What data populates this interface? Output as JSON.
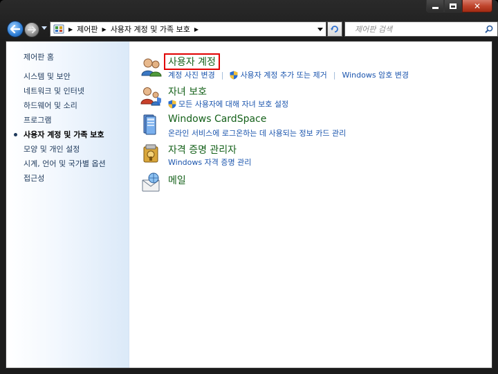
{
  "window": {
    "caption": {
      "minimize": "minimize",
      "maximize": "maximize",
      "close": "✕"
    }
  },
  "address": {
    "crumbs": [
      "제어판",
      "사용자 계정 및 가족 보호"
    ]
  },
  "search": {
    "placeholder": "제어판 검색"
  },
  "sidebar": {
    "home": "제어판 홈",
    "items": [
      {
        "label": "시스템 및 보안"
      },
      {
        "label": "네트워크 및 인터넷"
      },
      {
        "label": "하드웨어 및 소리"
      },
      {
        "label": "프로그램"
      },
      {
        "label": "사용자 계정 및 가족 보호",
        "current": true
      },
      {
        "label": "모양 및 개인 설정"
      },
      {
        "label": "시계, 언어 및 국가별 옵션"
      },
      {
        "label": "접근성"
      }
    ]
  },
  "categories": [
    {
      "title": "사용자 계정",
      "icon": "user-accounts-icon",
      "links": [
        {
          "label": "계정 사진 변경",
          "shield": false
        },
        {
          "label": "사용자 계정 추가 또는 제거",
          "shield": true
        },
        {
          "label": "Windows 암호 변경",
          "shield": false
        }
      ]
    },
    {
      "title": "자녀 보호",
      "icon": "parental-controls-icon",
      "links": [
        {
          "label": "모든 사용자에 대해 자녀 보호 설정",
          "shield": true
        }
      ]
    },
    {
      "title": "Windows CardSpace",
      "icon": "cardspace-icon",
      "links": [
        {
          "label": "온라인 서비스에 로그온하는 데 사용되는 정보 카드 관리",
          "shield": false
        }
      ]
    },
    {
      "title": "자격 증명 관리자",
      "icon": "credential-manager-icon",
      "links": [
        {
          "label": "Windows 자격 증명 관리",
          "shield": false
        }
      ]
    },
    {
      "title": "메일",
      "icon": "mail-icon",
      "links": []
    }
  ],
  "colors": {
    "link": "#1a54ad",
    "category_title": "#15611a",
    "highlight_box": "#e00000",
    "sidebar_text": "#1e395b"
  }
}
